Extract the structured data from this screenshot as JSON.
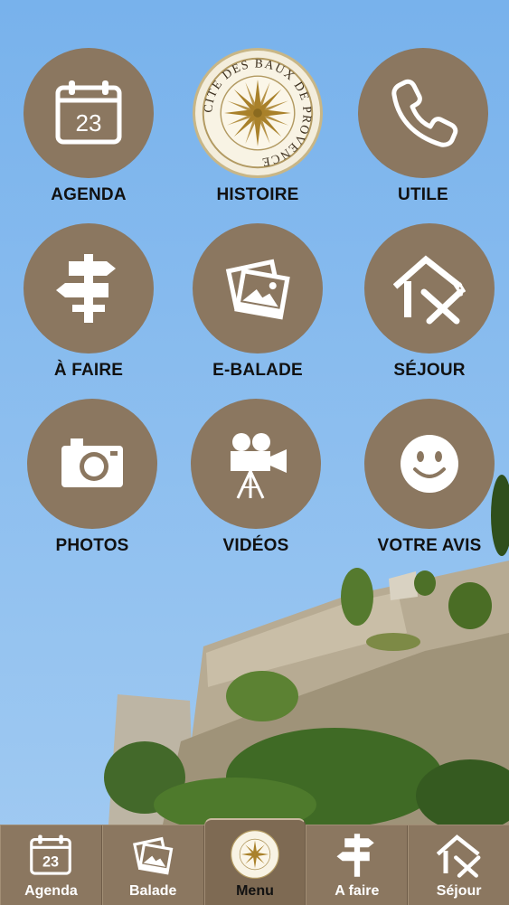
{
  "menu": {
    "tiles": [
      {
        "label": "AGENDA",
        "icon": "calendar-icon",
        "day": "23"
      },
      {
        "label": "HISTOIRE",
        "icon": "cite-des-baux-seal",
        "seal_text": "CITE DES BAUX DE PROVENCE"
      },
      {
        "label": "UTILE",
        "icon": "phone-icon"
      },
      {
        "label": "À FAIRE",
        "icon": "signpost-icon"
      },
      {
        "label": "E-BALADE",
        "icon": "photos-icon"
      },
      {
        "label": "SÉJOUR",
        "icon": "house-cutlery-icon"
      },
      {
        "label": "PHOTOS",
        "icon": "camera-icon"
      },
      {
        "label": "VIDÉOS",
        "icon": "movie-camera-icon"
      },
      {
        "label": "VOTRE AVIS",
        "icon": "smiley-icon"
      }
    ]
  },
  "tabbar": {
    "tabs": [
      {
        "label": "Agenda",
        "icon": "calendar-icon",
        "day": "23"
      },
      {
        "label": "Balade",
        "icon": "photos-icon"
      },
      {
        "label": "Menu",
        "icon": "cite-des-baux-seal",
        "active": true
      },
      {
        "label": "A faire",
        "icon": "signpost-icon"
      },
      {
        "label": "Séjour",
        "icon": "house-cutlery-icon"
      }
    ]
  },
  "colors": {
    "tile": "#8b7760",
    "sky": "#85b9ec",
    "tabbar": "#8b7760"
  }
}
